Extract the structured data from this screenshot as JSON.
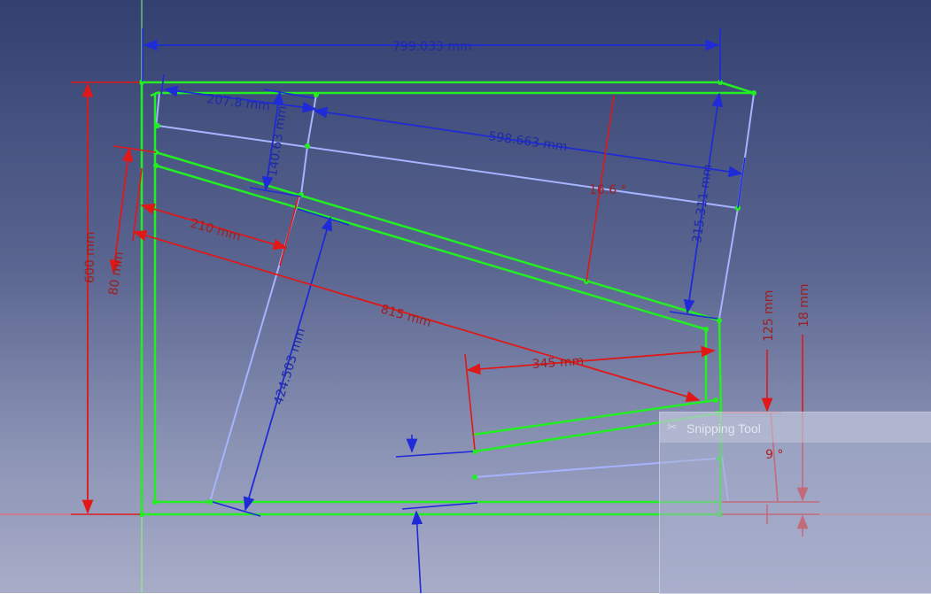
{
  "dimensions": {
    "width_top": "799.033 mm",
    "top_a": "207.8 mm",
    "top_b": "598.663 mm",
    "depth_a": "140.63 mm",
    "right_vertical": "315.311 mm",
    "long_diag": "424.503 mm",
    "height_total": "600 mm",
    "left_80": "80 mm",
    "seg_210": "210 mm",
    "seg_815": "815 mm",
    "seg_345": "345 mm",
    "angle_top": "16.6 °",
    "angle_bottom": "9 °",
    "right_125": "125 mm",
    "right_18": "18 mm"
  },
  "snipping_tool": {
    "title": "Snipping Tool",
    "icon": "scissors-icon"
  },
  "colors": {
    "sketch_green": "#22ee22",
    "construction_blue": "#a0b0ff",
    "dim_blue": "#1f2aa8",
    "dim_red": "#e01818"
  }
}
